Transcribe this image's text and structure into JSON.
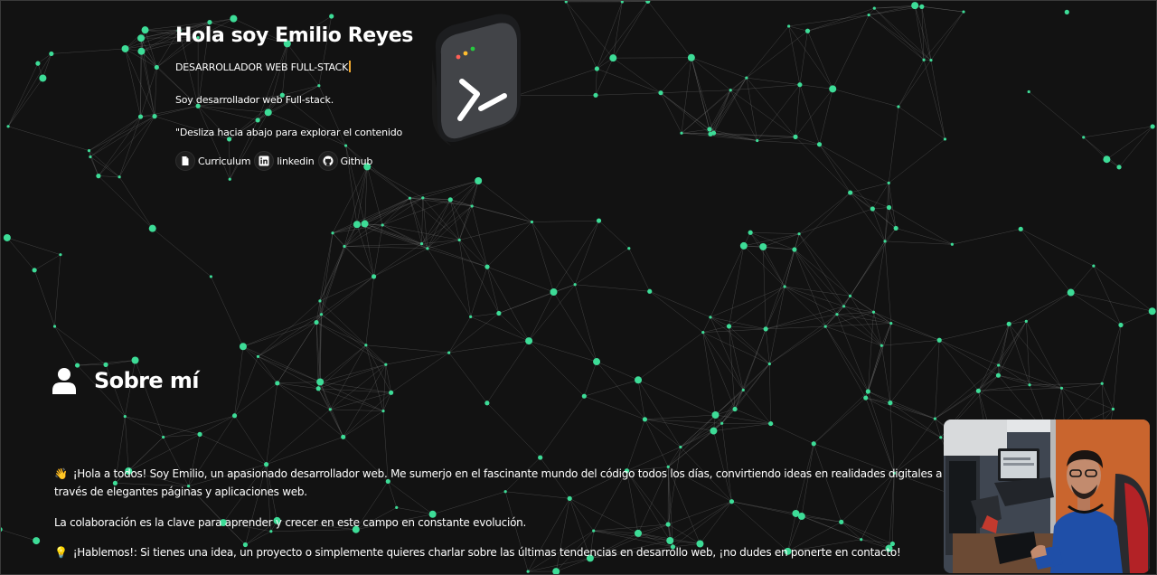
{
  "hero": {
    "title": "Hola soy Emilio Reyes",
    "subtitle": "DESARROLLADOR WEB FULL-STACK",
    "description": "Soy desarrollador web Full-stack.",
    "scroll_hint": "\"Desliza hacia abajo para explorar el contenido"
  },
  "links": [
    {
      "label": "Curriculum",
      "icon": "document-icon"
    },
    {
      "label": "linkedin",
      "icon": "linkedin-icon"
    },
    {
      "label": "Github",
      "icon": "github-icon"
    }
  ],
  "about": {
    "title": "Sobre mí",
    "icon": "user-icon",
    "paragraphs": [
      {
        "emoji": "👋",
        "text": "¡Hola a todos! Soy Emilio, un apasionado desarrollador web. Me sumerjo en el fascinante mundo del código todos los días, convirtiendo ideas en realidades digitales a través de elegantes páginas y aplicaciones web."
      },
      {
        "emoji": "",
        "text": "La colaboración es la clave para aprender y crecer en este campo en constante evolución."
      },
      {
        "emoji": "💡",
        "text": "¡Hablemos!: Si tienes una idea, un proyecto o simplemente quieres charlar sobre las últimas tendencias en desarrollo web, ¡no dudes en ponerte en contacto!"
      }
    ]
  },
  "colors": {
    "background": "#121212",
    "node": "#3ddc97",
    "caret": "#f0a830",
    "text": "#ffffff"
  }
}
